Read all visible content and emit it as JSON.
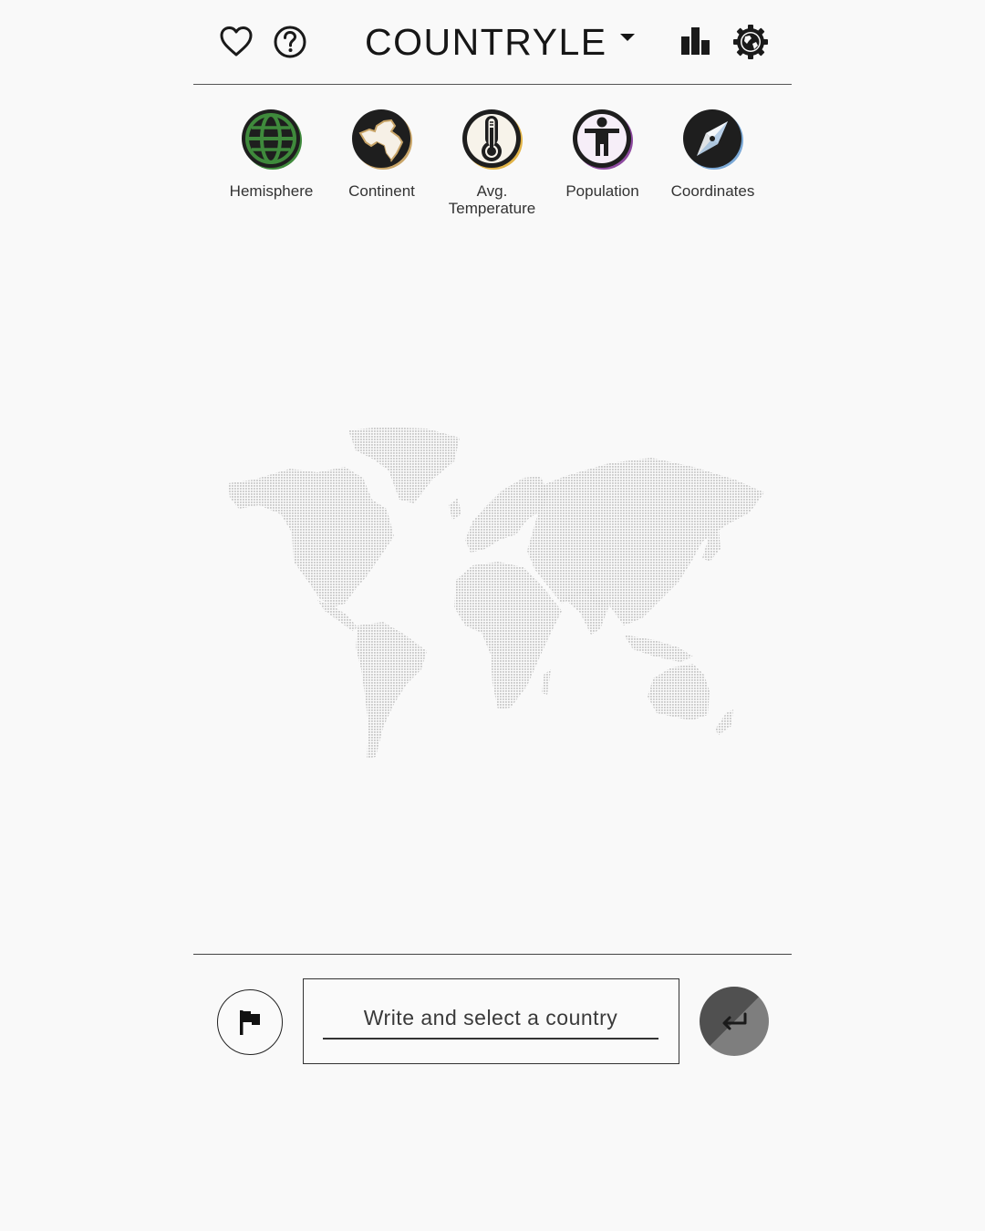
{
  "header": {
    "title": "COUNTRYLE",
    "icons": {
      "left": [
        "heart-icon",
        "help-icon"
      ],
      "right": [
        "stats-icon",
        "settings-icon"
      ]
    }
  },
  "hints": [
    {
      "label": "Hemisphere",
      "icon": "globe-icon",
      "accent": "#3f8a3c"
    },
    {
      "label": "Continent",
      "icon": "continent-icon",
      "accent": "#c9a568"
    },
    {
      "label": "Avg.\nTemperature",
      "icon": "thermometer-icon",
      "accent": "#e1b347"
    },
    {
      "label": "Population",
      "icon": "person-icon",
      "accent": "#8e4aa0"
    },
    {
      "label": "Coordinates",
      "icon": "compass-icon",
      "accent": "#7aa8d6"
    }
  ],
  "map": {
    "icon": "world-map-dotted",
    "color": "#cfcfcf"
  },
  "guess": {
    "placeholder": "Write and select a country",
    "flag_icon": "flag-icon",
    "submit_icon": "enter-icon"
  },
  "colors": {
    "background": "#f9f9f9",
    "text": "#1a1a1a",
    "submit": "#505050"
  }
}
